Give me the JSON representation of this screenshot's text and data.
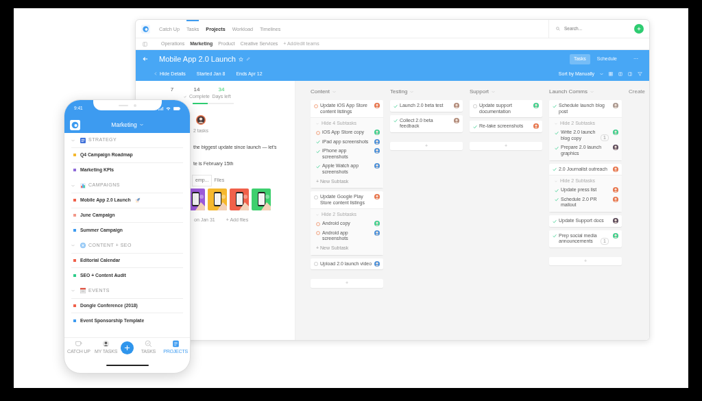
{
  "desktop": {
    "nav": {
      "tabs": [
        {
          "label": "Catch Up",
          "selected": false,
          "underlined": false
        },
        {
          "label": "Tasks",
          "selected": false,
          "underlined": true
        },
        {
          "label": "Projects",
          "selected": true,
          "underlined": false
        },
        {
          "label": "Workload",
          "selected": false,
          "underlined": false
        },
        {
          "label": "Timelines",
          "selected": false,
          "underlined": false
        }
      ],
      "search": {
        "placeholder": "Search..."
      }
    },
    "teams": {
      "items": [
        {
          "label": "Operations",
          "selected": false
        },
        {
          "label": "Marketing",
          "selected": true
        },
        {
          "label": "Product",
          "selected": false
        },
        {
          "label": "Creative Services",
          "selected": false
        }
      ],
      "edit_link": "+ Add/edit teams"
    },
    "project": {
      "title": "Mobile App 2.0 Launch",
      "hide_details": "Hide Details",
      "started": "Started Jan 8",
      "ends": "Ends Apr 12",
      "views": [
        {
          "label": "Tasks",
          "selected": true
        },
        {
          "label": "Schedule",
          "selected": false
        }
      ],
      "more": "···",
      "sort": "Sort by Manually"
    },
    "details": {
      "stats": [
        {
          "value": "7",
          "accent": false
        },
        {
          "value": "14",
          "label": "Complete",
          "accent": false
        },
        {
          "value": "34",
          "label": "Days left",
          "accent": true
        }
      ],
      "progress": {
        "level": 0.37
      },
      "assignee_caption": "2 tasks",
      "description": [
        "the biggest update since launch — let's",
        "te is February 15th"
      ],
      "file_tabs": [
        {
          "label": "emp...",
          "selected": true
        },
        {
          "label": "Files",
          "selected": false
        }
      ],
      "thumbnails": [
        {
          "color": "#9b59d9"
        },
        {
          "color": "#f5b82e"
        },
        {
          "color": "#f0604a"
        },
        {
          "color": "#3ecf6e"
        }
      ],
      "upload_note": "on Jan 31",
      "add_files": "+ Add files"
    },
    "board": {
      "columns": [
        {
          "title": "Content",
          "add": "+",
          "tasks": [
            {
              "title": "Update iOS App Store content listings",
              "kind": "progress",
              "color": "#e8734a",
              "toggle": "Hide 4 Subtasks",
              "new_subtask": "+ New Subtask",
              "subtasks": [
                {
                  "title": "iOS App Store copy",
                  "kind": "progress",
                  "color": "#3ecf8e"
                },
                {
                  "title": "iPad app screenshots",
                  "kind": "done",
                  "color": "#4a90d9"
                },
                {
                  "title": "iPhone app screenshots",
                  "kind": "done",
                  "color": "#4a90d9"
                },
                {
                  "title": "Apple Watch app screenshots",
                  "kind": "done",
                  "color": "#4a90d9"
                }
              ]
            },
            {
              "title": "Update Google Play Store content listings",
              "kind": "todo",
              "color": "#e8734a",
              "toggle": "Hide 2 Subtasks",
              "new_subtask": "+ New Subtask",
              "subtasks": [
                {
                  "title": "Android copy",
                  "kind": "progress",
                  "color": "#3ecf8e"
                },
                {
                  "title": "Android app screenshots",
                  "kind": "progress",
                  "color": "#4a90d9"
                }
              ]
            },
            {
              "title": "Upload 2.0 launch video",
              "kind": "todo",
              "color": "#4a90d9"
            }
          ]
        },
        {
          "title": "Testing",
          "add": "+",
          "tasks": [
            {
              "title": "Launch 2.0 beta test",
              "kind": "done",
              "color": "#b08a7a"
            },
            {
              "title": "Collect 2.0 beta feedback",
              "kind": "done",
              "color": "#b08a7a"
            }
          ]
        },
        {
          "title": "Support",
          "add": "+",
          "tasks": [
            {
              "title": "Update support documentation",
              "kind": "todo",
              "color": "#3ecf8e"
            },
            {
              "title": "Re-take screenshots",
              "kind": "done",
              "color": "#e8734a"
            }
          ]
        },
        {
          "title": "Launch Comms",
          "add": "+",
          "tasks": [
            {
              "title": "Schedule launch blog post",
              "kind": "done",
              "color": "#a89890",
              "toggle": "Hide 2 Subtasks",
              "subtasks": [
                {
                  "title": "Write 2.0 launch blog copy",
                  "kind": "done",
                  "color": "#3ecf8e",
                  "comments": "1"
                },
                {
                  "title": "Prepare 2.0 launch graphics",
                  "kind": "done",
                  "color": "#5a4a5a"
                }
              ]
            },
            {
              "title": "2.0 Journalist outreach",
              "kind": "done",
              "color": "#e8734a",
              "toggle": "Hide 2 Subtasks",
              "subtasks": [
                {
                  "title": "Update press list",
                  "kind": "done",
                  "color": "#e8734a"
                },
                {
                  "title": "Schedule 2.0 PR mailout",
                  "kind": "done",
                  "color": "#e8734a"
                }
              ]
            },
            {
              "title": "Update Support docs",
              "kind": "done",
              "color": "#5a4a5a"
            },
            {
              "title": "Prep social media announcements",
              "kind": "done",
              "color": "#3ecf8e",
              "comments": "1"
            }
          ]
        }
      ],
      "create_column": "Create"
    }
  },
  "phone": {
    "time": "9:41",
    "team": "Marketing",
    "groups": [
      {
        "title": "STRATEGY",
        "kind": "board",
        "expanded": true,
        "items": [
          {
            "label": "Q4 Campaign Roadmap",
            "color": "#f5b82e"
          },
          {
            "label": "Marketing KPIs",
            "color": "#8e6bd9"
          }
        ]
      },
      {
        "title": "CAMPAIGNS",
        "kind": "chart",
        "expanded": true,
        "items": [
          {
            "label": "Mobile App 2.0 Launch",
            "color": "#f0604a",
            "rocket": true
          },
          {
            "label": "June Campaign",
            "color": "#f2998a"
          },
          {
            "label": "Summer Campaign",
            "color": "#3d9bf0"
          }
        ]
      },
      {
        "title": "CONTENT + SEO",
        "kind": "snowflake",
        "expanded": true,
        "items": [
          {
            "label": "Editorial Calendar",
            "color": "#f0604a"
          },
          {
            "label": "SEO + Content Audit",
            "color": "#2ecc8a"
          }
        ]
      },
      {
        "title": "EVENTS",
        "kind": "calendar",
        "expanded": true,
        "items": [
          {
            "label": "Dongle Conference (2018)",
            "color": "#f0604a"
          },
          {
            "label": "Event Sponsorship Template",
            "color": "#3d9bf0"
          }
        ]
      }
    ],
    "tabs": [
      {
        "kind": "cup",
        "label": "CATCH UP",
        "selected": false
      },
      {
        "kind": "avatar",
        "label": "MY TASKS",
        "selected": false
      },
      {
        "kind": "add"
      },
      {
        "kind": "search",
        "label": "TASKS",
        "selected": false
      },
      {
        "kind": "projects",
        "label": "PROJECTS",
        "selected": true
      }
    ]
  }
}
